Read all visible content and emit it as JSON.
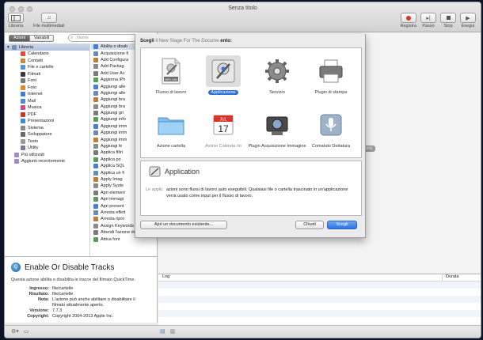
{
  "window": {
    "title": "Senza titolo"
  },
  "toolbar": {
    "left": [
      {
        "label": "Libreria",
        "icon": "library-icon"
      },
      {
        "label": "File multimediali",
        "icon": "media-icon"
      }
    ],
    "right": [
      {
        "label": "Registra",
        "icon": "record-icon"
      },
      {
        "label": "Passo",
        "icon": "step-icon"
      },
      {
        "label": "Stop",
        "icon": "stop-icon"
      },
      {
        "label": "Esegui",
        "icon": "run-icon"
      }
    ]
  },
  "left_panel": {
    "seg_actions": "Azioni",
    "seg_variables": "Variabili",
    "search_placeholder": "Nome",
    "library_header": "Libreria",
    "library_items": [
      {
        "label": "Calendario",
        "color": "#e04b3c"
      },
      {
        "label": "Contatti",
        "color": "#c08a3c"
      },
      {
        "label": "File e cartelle",
        "color": "#5a8fd8"
      },
      {
        "label": "Filmati",
        "color": "#3a3a3a"
      },
      {
        "label": "Font",
        "color": "#777777"
      },
      {
        "label": "Foto",
        "color": "#d98a2a"
      },
      {
        "label": "Internet",
        "color": "#3b7fd0"
      },
      {
        "label": "Mail",
        "color": "#4a8ad8"
      },
      {
        "label": "Musica",
        "color": "#d04a8a"
      },
      {
        "label": "PDF",
        "color": "#c0392b"
      },
      {
        "label": "Presentazioni",
        "color": "#3a8ad0"
      },
      {
        "label": "Sistema",
        "color": "#8a8a8a"
      },
      {
        "label": "Sviluppatore",
        "color": "#6a6a6a"
      },
      {
        "label": "Testo",
        "color": "#9a9a9a"
      },
      {
        "label": "Utility",
        "color": "#7a7a9a"
      }
    ],
    "library_extra": [
      "Più utilizzati",
      "Aggiunti recentemente"
    ],
    "actions": [
      "Abilita o disab",
      "Acquisizione fi",
      "Add Configura",
      "Add Packag",
      "Add User Ac",
      "Aggiorna iPh",
      "Aggiungi alle",
      "Aggiungi alle",
      "Aggiungi bra",
      "Aggiungi bra",
      "Aggiungi gri",
      "Aggiungi info",
      "Aggiungi imm",
      "Aggiungi imm",
      "Aggiungi imm",
      "Aggiungi le",
      "Applica filtri",
      "Applica po",
      "Applica SQL",
      "Applica un fi",
      "Apply Imag",
      "Apply Syste",
      "Apri element",
      "Apri immagi",
      "Apri present",
      "Arresta effett",
      "Arresta ripro",
      "Assign Keywords to Images",
      "Attendi l'azione dell'utente",
      "Attiva font"
    ]
  },
  "description": {
    "title": "Enable Or Disable Tracks",
    "summary": "Questa azione abilita o disabilita le tracce del filmato QuickTime.",
    "rows": [
      {
        "k": "Ingresso:",
        "v": "file/cartelle"
      },
      {
        "k": "Risultato:",
        "v": "file/cartelle"
      },
      {
        "k": "Nota:",
        "v": "L'azione può anche abilitare o disabilitare il"
      },
      {
        "k": "",
        "v": "filmato attualmente aperto."
      },
      {
        "k": "Versione:",
        "v": "7.7.3"
      },
      {
        "k": "Copyright:",
        "v": "Copyright 2004-2013 Apple Inc."
      }
    ]
  },
  "workflow": {
    "hint": "di lavoro."
  },
  "log": {
    "col_log": "Log",
    "col_duration": "Durata"
  },
  "sheet": {
    "title_bold_a": "Scegli",
    "title_light": "il New Stage For The Docume",
    "title_bold_b": "ento:",
    "tiles": [
      {
        "label": "Flusso di lavoro",
        "icon": "workflow-icon"
      },
      {
        "label": "Applicazione",
        "icon": "application-icon",
        "selected": true
      },
      {
        "label": "Servizio",
        "icon": "service-gear-icon"
      },
      {
        "label": "Plugin di stampa",
        "icon": "printer-icon"
      },
      {
        "label": "Azione cartella",
        "icon": "folder-icon"
      },
      {
        "label": "Avviso Calenda rio",
        "icon": "calendar-icon"
      },
      {
        "label": "Plugin Acquisizione Immagine",
        "icon": "camera-icon"
      },
      {
        "label": "Comando Dettatura",
        "icon": "microphone-icon"
      }
    ],
    "calendar_month": "JUL",
    "calendar_day": "17",
    "workflow_badge": "WFLOW",
    "info_title": "Application",
    "info_label": "Le applic",
    "info_text": "azioni sono flussi di lavoro auto eseguibili. Qualsiasi file o cartella trascinato in un'applicazione verrà usato come input per il flusso di lavoro.",
    "btn_open": "Apri un documento esistente...",
    "btn_close": "Chiudi",
    "btn_choose": "Scegli"
  }
}
